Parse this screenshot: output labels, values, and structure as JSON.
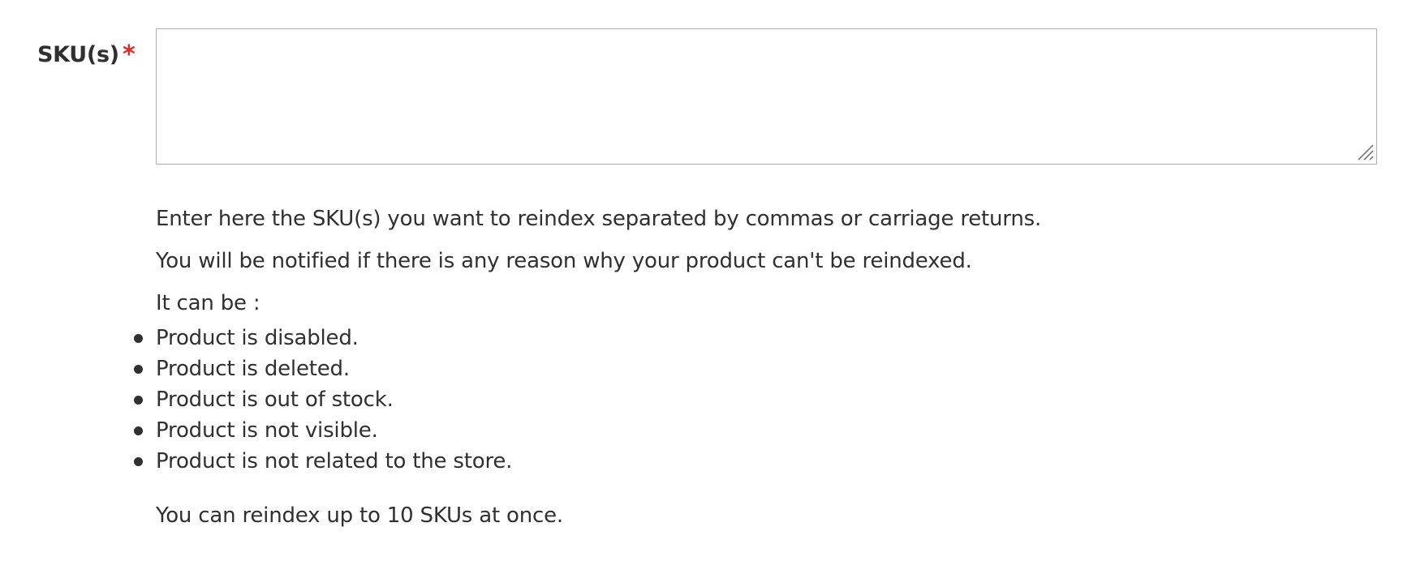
{
  "field": {
    "label": "SKU(s)",
    "required_marker": "*",
    "value": ""
  },
  "help": {
    "line1": "Enter here the SKU(s) you want to reindex separated by commas or carriage returns.",
    "line2": "You will be notified if there is any reason why your product can't be reindexed.",
    "line3": "It can be :",
    "reasons": [
      "Product is disabled.",
      "Product is deleted.",
      "Product is out of stock.",
      "Product is not visible.",
      "Product is not related to the store."
    ],
    "limit": "You can reindex up to 10 SKUs at once."
  },
  "colors": {
    "required": "#e02b27",
    "text": "#303030",
    "border": "#adadad"
  }
}
